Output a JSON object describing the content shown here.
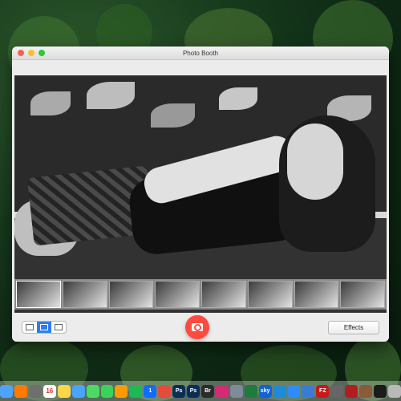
{
  "window": {
    "title": "Photo Booth"
  },
  "toolbar": {
    "effects_label": "Effects"
  },
  "dock": {
    "apps": [
      {
        "name": "finder",
        "label": "",
        "color": "#4da3ff"
      },
      {
        "name": "firefox",
        "label": "",
        "color": "#ff7a00"
      },
      {
        "name": "launchpad",
        "label": "",
        "color": "#6f6f6f"
      },
      {
        "name": "calendar",
        "label": "16",
        "color": "#ffffff"
      },
      {
        "name": "notes",
        "label": "",
        "color": "#ffd54a"
      },
      {
        "name": "mail",
        "label": "",
        "color": "#4aa3ff"
      },
      {
        "name": "messages",
        "label": "",
        "color": "#4cd964"
      },
      {
        "name": "facetime",
        "label": "",
        "color": "#3ad35a"
      },
      {
        "name": "photos",
        "label": "",
        "color": "#ff9a00"
      },
      {
        "name": "spotify",
        "label": "",
        "color": "#1db954"
      },
      {
        "name": "onepassword",
        "label": "1",
        "color": "#0f6cff"
      },
      {
        "name": "chrome",
        "label": "",
        "color": "#e44b3a"
      },
      {
        "name": "photoshop",
        "label": "Ps",
        "color": "#0a2e59"
      },
      {
        "name": "photoshop-alt",
        "label": "Ps",
        "color": "#0a2e59"
      },
      {
        "name": "bridge",
        "label": "Br",
        "color": "#2b2b2b"
      },
      {
        "name": "instagram",
        "label": "",
        "color": "#d62976"
      },
      {
        "name": "scripteditor",
        "label": "",
        "color": "#7f8a9a"
      },
      {
        "name": "excel",
        "label": "",
        "color": "#1f7a3d"
      },
      {
        "name": "sky",
        "label": "sky",
        "color": "#0b64d8"
      },
      {
        "name": "vscode",
        "label": "",
        "color": "#1f8bd8"
      },
      {
        "name": "safari",
        "label": "",
        "color": "#2f8cff"
      },
      {
        "name": "vmware",
        "label": "",
        "color": "#3a7bd5"
      },
      {
        "name": "filezilla",
        "label": "FZ",
        "color": "#c71919"
      },
      {
        "name": "preview",
        "label": "",
        "color": "#666666"
      },
      {
        "name": "photo-booth",
        "label": "",
        "color": "#b31d1d"
      },
      {
        "name": "cat",
        "label": "",
        "color": "#8a5a3a"
      },
      {
        "name": "terminal",
        "label": "",
        "color": "#1b1b1b"
      },
      {
        "name": "trash",
        "label": "",
        "color": "#b9b9b9"
      }
    ]
  }
}
